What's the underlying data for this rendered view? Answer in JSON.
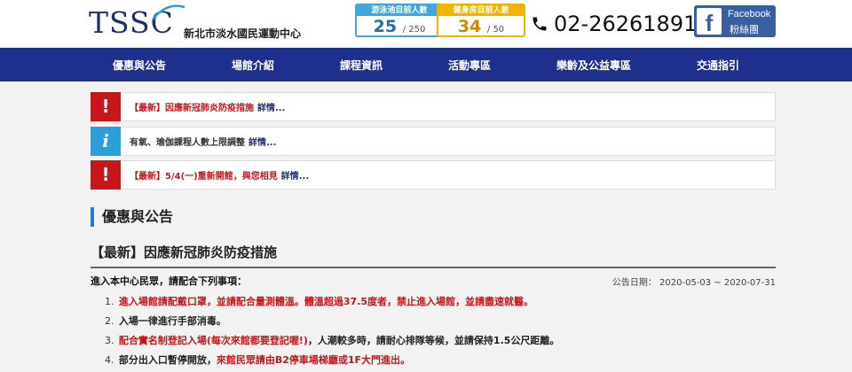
{
  "header": {
    "logo_text": "TSSC",
    "logo_subtitle": "新北市淡水國民運動中心",
    "pool_counter": {
      "title": "游泳池目前人數",
      "value": "25",
      "capacity": "/ 250"
    },
    "gym_counter": {
      "title": "健身房目前人數",
      "value": "34",
      "capacity": "/ 50"
    },
    "phone": "02-26261891",
    "facebook": {
      "line1": "Facebook",
      "line2": "粉絲團"
    }
  },
  "nav": {
    "items": [
      "優惠與公告",
      "場館介紹",
      "課程資訊",
      "活動專區",
      "樂齡及公益專區",
      "交通指引"
    ]
  },
  "notices": [
    {
      "icon": "!",
      "text": "【最新】因應新冠肺炎防疫措施",
      "more": "詳情..."
    },
    {
      "icon": "i",
      "text": "有氧、瑜伽課程人數上限調整",
      "more": "詳情..."
    },
    {
      "icon": "!",
      "text": "【最新】5/4(一)重新開館，與您相見",
      "more": "詳情..."
    }
  ],
  "section": {
    "title": "優惠與公告"
  },
  "article": {
    "title": "【最新】因應新冠肺炎防疫措施",
    "intro": "進入本中心民眾，請配合下列事項：",
    "date": "公告日期： 2020-05-03 ~ 2020-07-31",
    "items": [
      {
        "num": "1.",
        "red": "進入場館請配戴口罩，並請配合量測體溫。體溫超過37.5度者，禁止進入場館，並請盡速就醫。",
        "dark": ""
      },
      {
        "num": "2.",
        "red": "",
        "dark": "入場一律進行手部消毒。"
      },
      {
        "num": "3.",
        "red": "配合實名制登記入場(每次來館都要登記喔!)",
        "dark": "，人潮較多時，請耐心排隊等候，並請保持1.5公尺距離。"
      },
      {
        "num": "4.",
        "dark_pre": "部分出入口暫停開放，",
        "red": "來館民眾請由B2停車場梯廳或1F大門進出。",
        "dark": ""
      }
    ]
  }
}
